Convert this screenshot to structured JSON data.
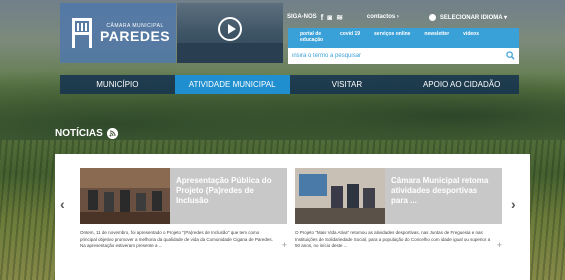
{
  "logo": {
    "small": "CÂMARA MUNICIPAL",
    "big": "PAREDES"
  },
  "topbar": {
    "siga": "SIGA-NOS",
    "social": [
      "f",
      "◙",
      "≋"
    ],
    "contactos": "contactos ›",
    "language": "SELECIONAR IDIOMA ▾"
  },
  "quick_links": [
    "portal de educação",
    "covid 19",
    "serviços online",
    "newsletter",
    "vídeos"
  ],
  "search": {
    "placeholder": "insira o termo a pesquisar"
  },
  "nav": [
    "MUNICÍPIO",
    "ATIVIDADE MUNICIPAL",
    "VISITAR",
    "APOIO AO CIDADÃO"
  ],
  "news_heading": "NOTÍCIAS",
  "news": [
    {
      "title": "Apresentação Pública do Projeto (Pa)redes de Inclusão",
      "desc": "Ontem, 11 de novembro, foi apresentado o Projeto \"(Pa)redes de Inclusão\" que tem como principal objetivo promover a melhoria da qualidade de vida da Comunidade Cigana de Paredes. Na apresentação estiveram presente a ..."
    },
    {
      "title": "Câmara Municipal retoma atividades desportivas para ...",
      "desc": "O Projeto \"Mais Vida Ativa\" retomou as atividades desportivas, nas Juntas de Freguesia e nas Instituições de Solidariedade Social, para a população do Concelho com idade igual ou superior a 50 anos, no início deste ..."
    }
  ],
  "colors": {
    "accent": "#3aa0d8",
    "nav_active": "#1f8fd0"
  }
}
